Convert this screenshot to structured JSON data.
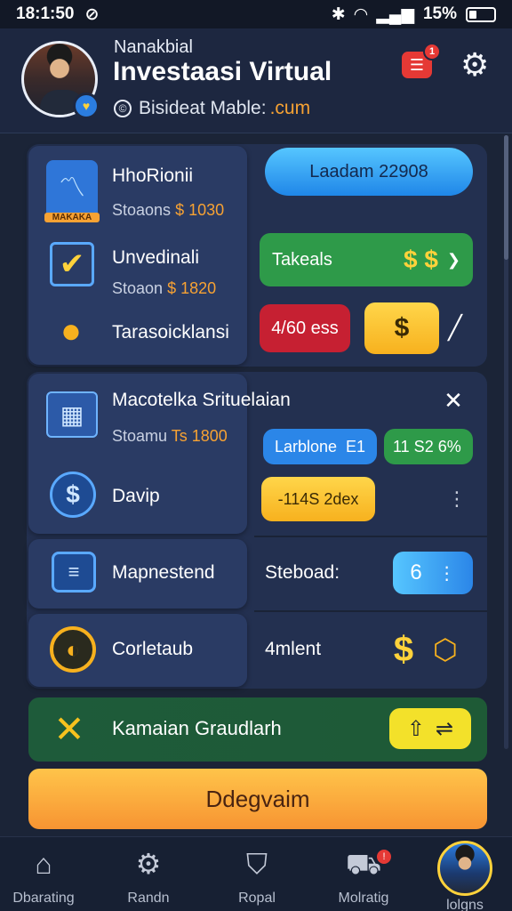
{
  "status_bar": {
    "time": "18:1:50",
    "battery": "15%"
  },
  "header": {
    "small_label": "Nanakbial",
    "title": "Investaasi Virtual",
    "site_prefix": "Bisideat Mable:",
    "site_accent": ".cum",
    "notification_count": "1"
  },
  "section1": {
    "items": [
      {
        "title": "HhoRionii",
        "sub_label": "Stoaons",
        "sub_value": "$ 1030",
        "icon_label": "MAKAKA"
      },
      {
        "title": "Unvedinali",
        "sub_label": "Stoaon",
        "sub_value": "$ 1820"
      },
      {
        "title": "Tarasoicklansi"
      }
    ],
    "primary_button": "Laadam 22908",
    "green_pill_label": "Takeals",
    "green_pill_symbols": "$ $",
    "red_pill": "4/60 ess",
    "yellow_icon": "$"
  },
  "section2": {
    "items": [
      {
        "title": "Macotelka Srituelaian",
        "sub_label": "Stoamu",
        "sub_value": "Ts 1800"
      },
      {
        "title": "Davip"
      },
      {
        "title": "Mapnestend",
        "right_label": "Steboad:",
        "right_value": "6"
      },
      {
        "title": "Corletaub",
        "right_label": "4mlent"
      }
    ],
    "blue_pill": "Larblone",
    "blue_pill_suffix": "E1",
    "green_pill": "11 S2 6%",
    "yellow_pill": "-114S 2dex"
  },
  "banner": {
    "title": "Kamaian Graudlarh"
  },
  "cta": {
    "label": "Ddegvaim"
  },
  "nav": {
    "items": [
      {
        "label": "Dbarating"
      },
      {
        "label": "Randn"
      },
      {
        "label": "Ropal"
      },
      {
        "label": "Molratig",
        "badge": "!"
      },
      {
        "label": "lolgns"
      }
    ]
  },
  "colors": {
    "background": "#1b2437",
    "accent_orange": "#f7a233",
    "blue": "#1f86e8",
    "green": "#2e9a49",
    "red": "#c62032",
    "yellow": "#ffd23b"
  }
}
